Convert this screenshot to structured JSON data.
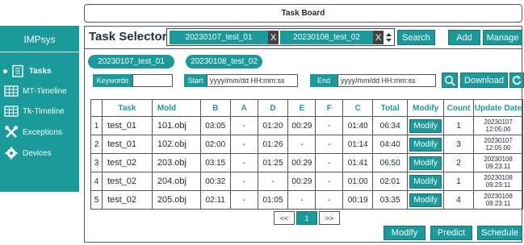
{
  "app": {
    "title": "Task Board",
    "brand": "IMPsys"
  },
  "sidebar": {
    "items": [
      {
        "label": "Tasks",
        "icon": "clipboard-icon",
        "active": true
      },
      {
        "label": "MT-Timeline",
        "icon": "grid-icon"
      },
      {
        "label": "Tk-Timeline",
        "icon": "grid-icon"
      },
      {
        "label": "Exceptions",
        "icon": "tools-icon"
      },
      {
        "label": "Devices",
        "icon": "gear-icon"
      }
    ]
  },
  "selector": {
    "title": "Task Selector",
    "chips": [
      "20230107_test_01",
      "20230108_test_02"
    ],
    "chip_remove": "X",
    "search_label": "Search",
    "add_label": "Add",
    "manage_label": "Manage"
  },
  "tabs": [
    "20230107_test_01",
    "20230108_test_02"
  ],
  "filters": {
    "keywords_label": "Keywords",
    "keywords_value": "",
    "start_label": "Start",
    "start_placeholder": "yyyy/mm/dd HH:mm:ss",
    "end_label": "End",
    "end_placeholder": "yyyy/mm/dd HH:mm:ss",
    "download_label": "Download"
  },
  "table": {
    "headers": [
      "",
      "Task",
      "Mold",
      "B",
      "A",
      "D",
      "E",
      "F",
      "C",
      "Total",
      "Modify",
      "Count",
      "Update Date"
    ],
    "modify_label": "Modify",
    "rows": [
      {
        "n": "1",
        "task": "test_01",
        "mold": "101.obj",
        "b": "03:05",
        "a": "-",
        "d": "01:20",
        "e": "00:29",
        "f": "-",
        "c": "01:40",
        "total": "06:34",
        "count": "1",
        "date1": "20230107",
        "date2": "12:05:00"
      },
      {
        "n": "2",
        "task": "test_01",
        "mold": "102.obj",
        "b": "02:00",
        "a": "-",
        "d": "01:26",
        "e": "-",
        "f": "-",
        "c": "01:14",
        "total": "04:40",
        "count": "3",
        "date1": "20230107",
        "date2": "12:05:00"
      },
      {
        "n": "3",
        "task": "test_02",
        "mold": "203.obj",
        "b": "03:15",
        "a": "-",
        "d": "01:25",
        "e": "00:29",
        "f": "-",
        "c": "01:41",
        "total": "06:50",
        "count": "2",
        "date1": "20230108",
        "date2": "09:23:11"
      },
      {
        "n": "4",
        "task": "test_02",
        "mold": "204.obj",
        "b": "00:32",
        "a": "-",
        "d": "-",
        "e": "00:29",
        "f": "-",
        "c": "01:00",
        "total": "02:01",
        "count": "1",
        "date1": "20230108",
        "date2": "09:23:11"
      },
      {
        "n": "5",
        "task": "test_02",
        "mold": "205.obj",
        "b": "02:11",
        "a": "-",
        "d": "01:05",
        "e": "-",
        "f": "-",
        "c": "00:19",
        "total": "03:35",
        "count": "4",
        "date1": "20230108",
        "date2": "09:23:11"
      }
    ]
  },
  "pagination": {
    "prev": "<<",
    "current": "1",
    "next": ">>"
  },
  "footer": {
    "modify_label": "Modify",
    "predict_label": "Predict",
    "schedule_label": "Schedule"
  },
  "colors": {
    "accent": "#1a9a9a",
    "border": "#556677",
    "chip_close": "#444444"
  }
}
